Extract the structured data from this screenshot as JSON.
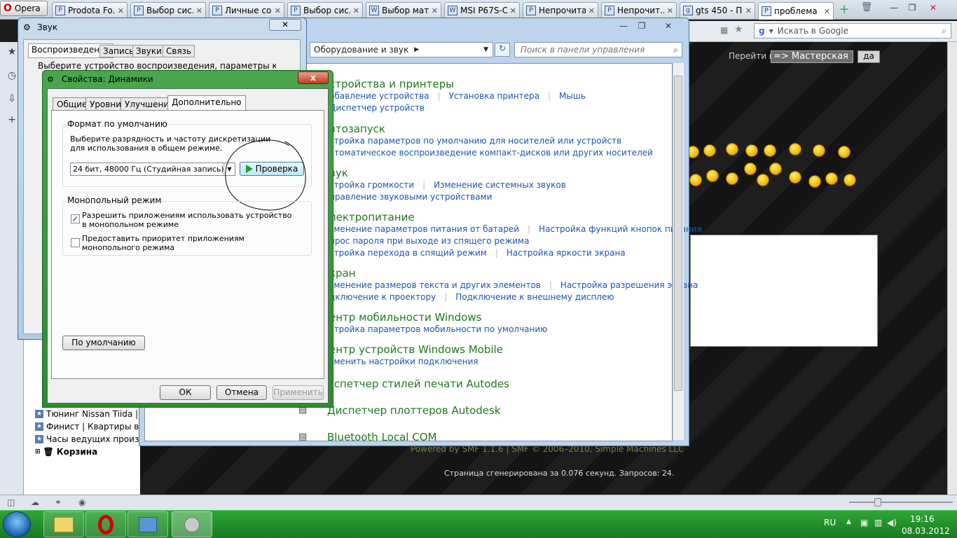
{
  "browser": {
    "menu_label": "Opera",
    "tabs": [
      {
        "title": "Prodota Fo...",
        "icon": "P"
      },
      {
        "title": "Выбор сис...",
        "icon": "P"
      },
      {
        "title": "Личные со...",
        "icon": "P"
      },
      {
        "title": "Выбор сис...",
        "icon": "P"
      },
      {
        "title": "Выбор мат...",
        "icon": "W"
      },
      {
        "title": "MSI P67S-C...",
        "icon": "W"
      },
      {
        "title": "Непрочита...",
        "icon": "P"
      },
      {
        "title": "Непрочит...",
        "icon": "P"
      },
      {
        "title": "gts 450 - П...",
        "icon": "g"
      },
      {
        "title": "проблема ...",
        "icon": "P"
      }
    ],
    "search_placeholder": "Искать в Google",
    "bookmarks": [
      "Тюнинг Nissan Tiida |...",
      "Финист | Квартиры вт...",
      "Часы ведущих произв...",
      "Корзина"
    ]
  },
  "forum": {
    "nav_label": "Перейти в:",
    "nav_value": "=> Мастерская",
    "nav_button": "да",
    "footer": "Powered by SMF 1.1.6 | SMF © 2006–2010, Simple Machines LLC",
    "footer_stats": "Страница сгенерирована за 0.076 секунд. Запросов: 24."
  },
  "control_panel": {
    "breadcrumb": "Оборудование и звук",
    "search_placeholder": "Поиск в панели управления",
    "sections": [
      {
        "title": "стройства и принтеры",
        "links": [
          "обавление устройства",
          "Установка принтера",
          "Мышь"
        ],
        "extra": [
          "Диспетчер устройств"
        ]
      },
      {
        "title": "втозапуск",
        "links": [
          "стройка параметров по умолчанию для носителей или устройств"
        ],
        "extra": [
          "втоматическое воспроизведение компакт-дисков или других носителей"
        ]
      },
      {
        "title": "вук",
        "links": [
          "стройка громкости",
          "Изменение системных звуков"
        ],
        "extra": [
          "правление звуковыми устройствами"
        ]
      },
      {
        "title": "лектропитание",
        "links": [
          "зменение параметров питания от батарей",
          "Настройка функций кнопок питания"
        ],
        "extra": [
          "прос пароля при выходе из спящего режима"
        ],
        "extra2": [
          "стройка перехода в спящий режим",
          "Настройка яркости экрана"
        ]
      },
      {
        "title": "кран",
        "links": [
          "зменение размеров текста и других элементов",
          "Настройка разрешения экрана"
        ],
        "extra": [
          "дключение к проектору",
          "Подключение к внешнему дисплею"
        ]
      },
      {
        "title": "ентр мобильности Windows",
        "links": [
          "стройка параметров мобильности по умолчанию"
        ]
      },
      {
        "title": "ентр устройств Windows Mobile",
        "links": [
          "зменить настройки подключения"
        ]
      },
      {
        "title": "испетчер стилей печати Autodes"
      },
      {
        "title": "Диспетчер плоттеров Autodesk"
      },
      {
        "title": "Bluetooth Local COM"
      }
    ]
  },
  "sound_window": {
    "title": "Звук",
    "tabs": [
      "Воспроизведение",
      "Запись",
      "Звуки",
      "Связь"
    ],
    "description": "Выберите устройство воспроизведения, параметры которого"
  },
  "properties_window": {
    "title": "Свойства: Динамики",
    "close_label": "x",
    "tabs": [
      "Общие",
      "Уровни",
      "Улучшения",
      "Дополнительно"
    ],
    "format_group": "Формат по умолчанию",
    "format_desc": "Выберите разрядность и частоту дискретизации для использования в общем режиме.",
    "format_value": "24 бит, 48000 Гц (Студийная запись)",
    "test_button": "Проверка",
    "exclusive_group": "Монопольный режим",
    "exclusive_option1": "Разрешить приложениям использовать устройство в монопольном режиме",
    "exclusive_option1_checked": true,
    "exclusive_option2": "Предоставить приоритет приложениям монопольного режима",
    "exclusive_option2_checked": false,
    "default_button": "По умолчанию",
    "ok_button": "ОК",
    "cancel_button": "Отмена",
    "apply_button": "Применить"
  },
  "taskbar": {
    "language": "RU",
    "time": "19:16",
    "date": "08.03.2012"
  }
}
